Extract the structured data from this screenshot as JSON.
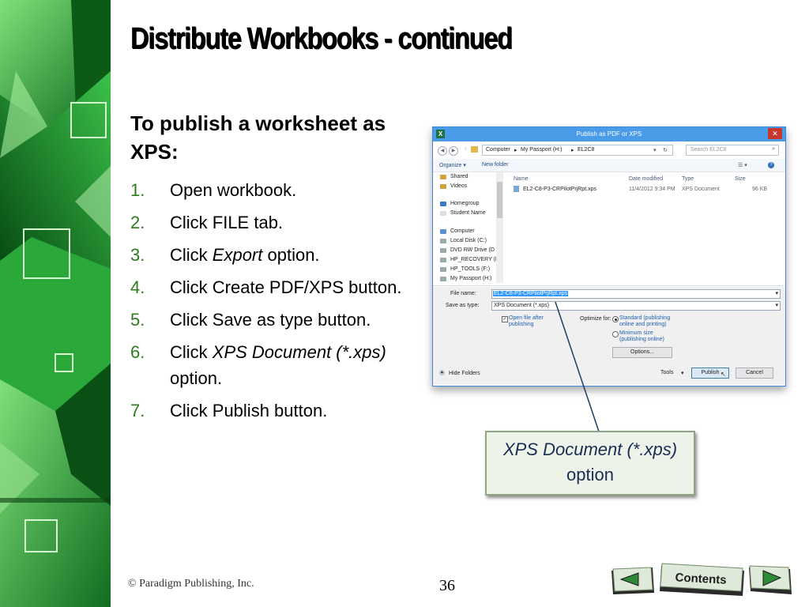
{
  "slide": {
    "title": "Distribute Workbooks - continued",
    "heading": "To publish a worksheet as XPS:",
    "steps": [
      {
        "num": "1.",
        "pre": "Open workbook.",
        "em": "",
        "post": ""
      },
      {
        "num": "2.",
        "pre": "Click FILE tab.",
        "em": "",
        "post": ""
      },
      {
        "num": "3.",
        "pre": "Click ",
        "em": "Export",
        "post": " option."
      },
      {
        "num": "4.",
        "pre": "Click Create PDF/XPS button.",
        "em": "",
        "post": ""
      },
      {
        "num": "5.",
        "pre": "Click Save as type button.",
        "em": "",
        "post": ""
      },
      {
        "num": "6.",
        "pre": "Click ",
        "em": "XPS Document (*.xps)",
        "post": " option."
      },
      {
        "num": "7.",
        "pre": "Click Publish button.",
        "em": "",
        "post": ""
      }
    ],
    "callout_line1": "XPS Document (*.xps)",
    "callout_line2": "option",
    "copyright": "© Paradigm Publishing, Inc.",
    "page_number": "36",
    "contents_label": "Contents",
    "colors": {
      "accent_green": "#2f7a1f",
      "dialog_blue": "#4a9be8",
      "callout_text": "#1a2d52"
    }
  },
  "dialog": {
    "title": "Publish as PDF or XPS",
    "app_icon": "X",
    "close_glyph": "✕",
    "breadcrumbs": [
      "Computer",
      "My Passport (H:)",
      "EL2C8"
    ],
    "search_placeholder": "Search EL2C8",
    "organize": "Organize ▾",
    "new_folder": "New folder",
    "nav_items": [
      "Shared",
      "Videos",
      "Homegroup",
      "Student Name",
      "Computer",
      "Local Disk (C:)",
      "DVD RW Drive (D",
      "HP_RECOVERY (E",
      "HP_TOOLS (F:)",
      "My Passport (H:)"
    ],
    "columns": {
      "name": "Name",
      "date": "Date modified",
      "type": "Type",
      "size": "Size"
    },
    "file": {
      "name": "EL2-C8-P3-CRPilotPrjRpt.xps",
      "date": "11/4/2012 9:34 PM",
      "type": "XPS Document",
      "size": "96 KB"
    },
    "file_name_label": "File name:",
    "file_name_value": "EL2-C8-P3-CRPilotPrjRpt.xps",
    "save_type_label": "Save as type:",
    "save_type_value": "XPS Document (*.xps)",
    "open_after": "Open file after publishing",
    "optimize_label": "Optimize for:",
    "opt_standard": "Standard (publishing online and printing)",
    "opt_minimum": "Minimum size (publishing online)",
    "options_btn": "Options...",
    "hide_folders": "Hide Folders",
    "tools": "Tools",
    "publish": "Publish",
    "cancel": "Cancel"
  }
}
